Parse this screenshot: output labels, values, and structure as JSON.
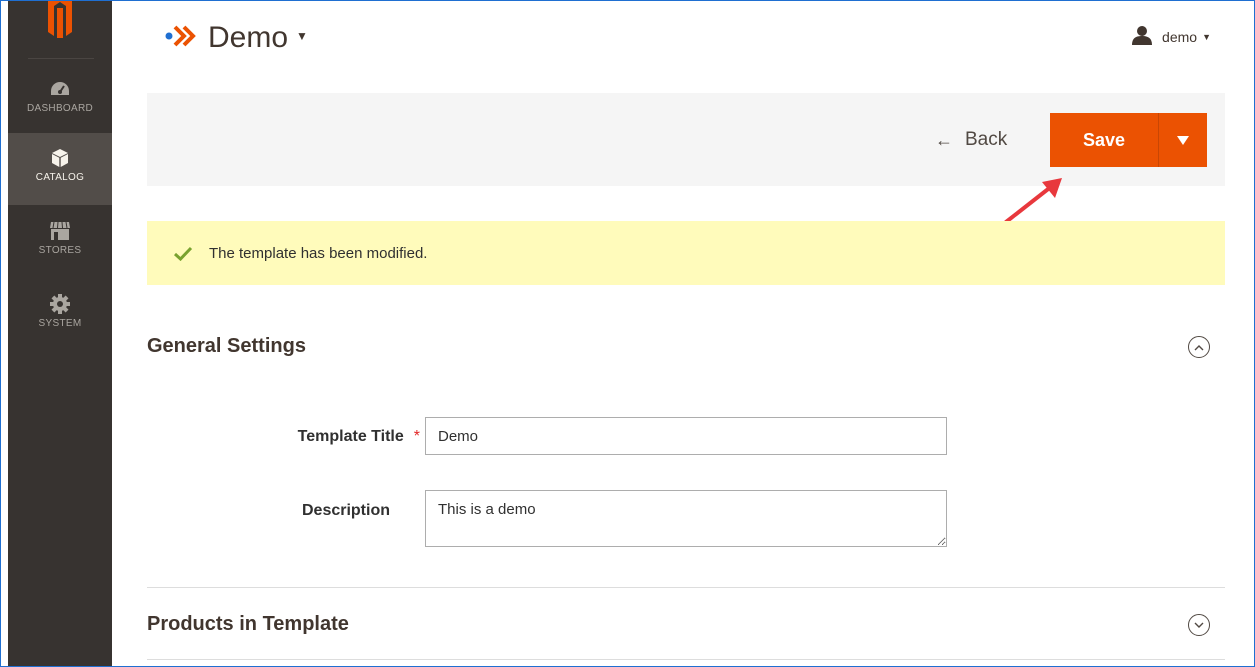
{
  "sidebar": {
    "items": [
      {
        "label": "DASHBOARD",
        "icon": "dashboard-icon",
        "active": false
      },
      {
        "label": "CATALOG",
        "icon": "catalog-icon",
        "active": true
      },
      {
        "label": "STORES",
        "icon": "stores-icon",
        "active": false
      },
      {
        "label": "SYSTEM",
        "icon": "gear-icon",
        "active": false
      }
    ]
  },
  "header": {
    "title": "Demo",
    "user": "demo"
  },
  "actions": {
    "back_label": "Back",
    "save_label": "Save"
  },
  "message": {
    "text": "The template has been modified."
  },
  "general_settings": {
    "title": "General Settings",
    "template_title_label": "Template Title",
    "required_mark": "*",
    "template_title_value": "Demo",
    "description_label": "Description",
    "description_value": "This is a demo"
  },
  "products_section": {
    "title": "Products in Template"
  },
  "colors": {
    "accent": "#eb5202",
    "sidebar": "#373330",
    "message_bg": "#fffbbb",
    "success": "#79a22e"
  }
}
